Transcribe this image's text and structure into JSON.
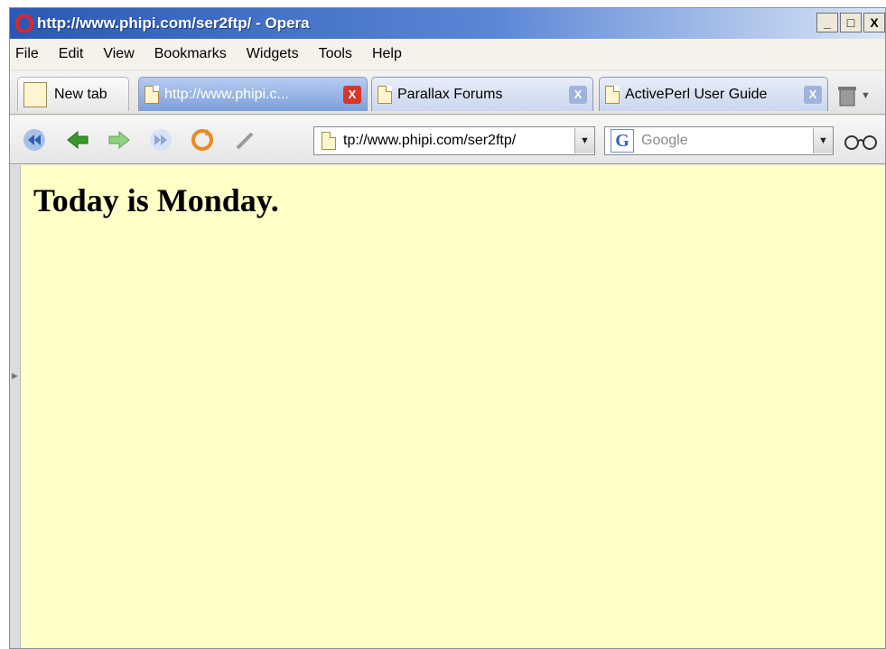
{
  "window": {
    "title": "http://www.phipi.com/ser2ftp/ - Opera",
    "controls": {
      "minimize": "_",
      "maximize": "□",
      "close": "X"
    }
  },
  "menu": [
    "File",
    "Edit",
    "View",
    "Bookmarks",
    "Widgets",
    "Tools",
    "Help"
  ],
  "tabs": [
    {
      "label": "New tab",
      "icon": "new-tab-icon"
    },
    {
      "label": "http://www.phipi.c...",
      "icon": "document-icon",
      "active": true,
      "close": "X"
    },
    {
      "label": "Parallax Forums",
      "icon": "document-icon",
      "close": "X"
    },
    {
      "label": "ActivePerl User Guide",
      "icon": "document-icon",
      "close": "X"
    }
  ],
  "toolbar": {
    "buttons": [
      "rewind-icon",
      "back-icon",
      "forward-icon",
      "fast-forward-icon",
      "reload-icon",
      "edit-pen-icon"
    ],
    "address": "tp://www.phipi.com/ser2ftp/",
    "search_engine_glyph": "G",
    "search_placeholder": "Google",
    "dropdown_glyph": "▼"
  },
  "page": {
    "heading": "Today is Monday.",
    "background": "#ffffc8"
  },
  "colors": {
    "titlebar": "#2a58b4",
    "active_tab": "#7e9fdc",
    "close_red": "#d9362a"
  }
}
